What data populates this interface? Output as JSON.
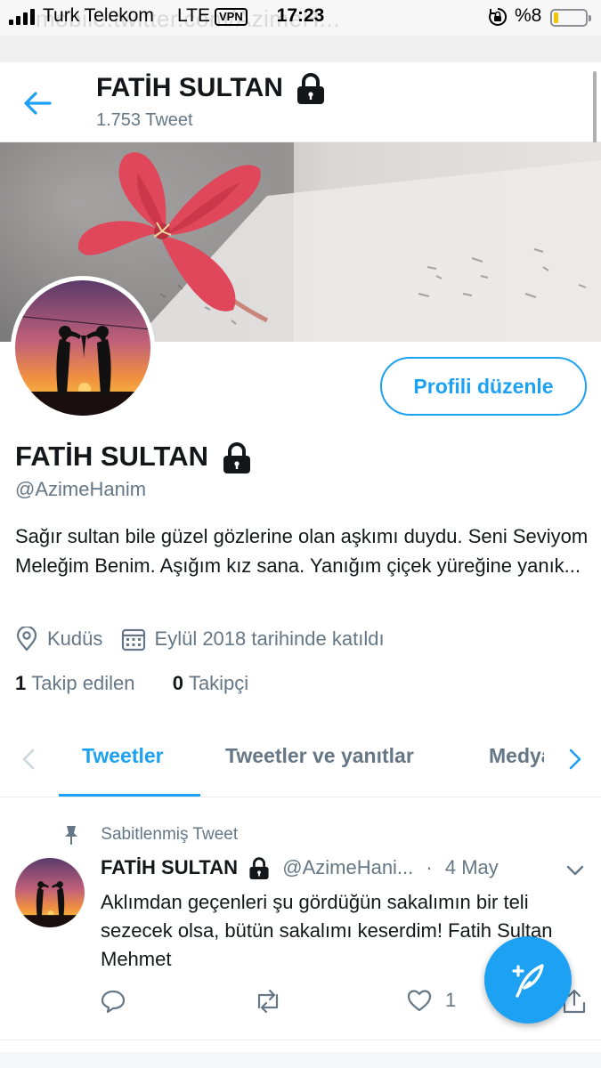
{
  "status_bar": {
    "carrier": "Turk Telekom",
    "network": "LTE",
    "vpn": "VPN",
    "time": "17:23",
    "battery": "%8",
    "battery_level": 0.08,
    "faded_url": "mobile.twitter.com/AzimeH..."
  },
  "header": {
    "title": "FATİH SULTAN",
    "tweet_count": "1.753 Tweet"
  },
  "profile": {
    "edit_button": "Profili düzenle",
    "name": "FATİH SULTAN",
    "handle": "@AzimeHanim",
    "bio": "Sağır sultan bile güzel gözlerine olan aşkımı duydu. Seni Seviyom Meleğim Benim. Aşığım kız sana. Yanığım çiçek yüreğine yanık...",
    "location": "Kudüs",
    "joined": "Eylül 2018 tarihinde katıldı",
    "following_count": "1",
    "following_label": "Takip edilen",
    "followers_count": "0",
    "followers_label": "Takipçi"
  },
  "tabs": [
    {
      "label": "Tweetler",
      "active": true
    },
    {
      "label": "Tweetler ve yanıtlar",
      "active": false
    },
    {
      "label": "Medya",
      "active": false
    }
  ],
  "pinned_tweet": {
    "pinned_label": "Sabitlenmiş Tweet",
    "author_name": "FATİH SULTAN",
    "author_handle": "@AzimeHani...",
    "separator": "·",
    "date": "4 May",
    "text": "Aklımdan geçenleri şu gördüğün sakalımın bir teli sezecek olsa, bütün sakalımı keserdim! Fatih Sultan Mehmet",
    "like_count": "1"
  },
  "colors": {
    "accent": "#1da1f2",
    "text_primary": "#14171a",
    "text_secondary": "#657786"
  }
}
